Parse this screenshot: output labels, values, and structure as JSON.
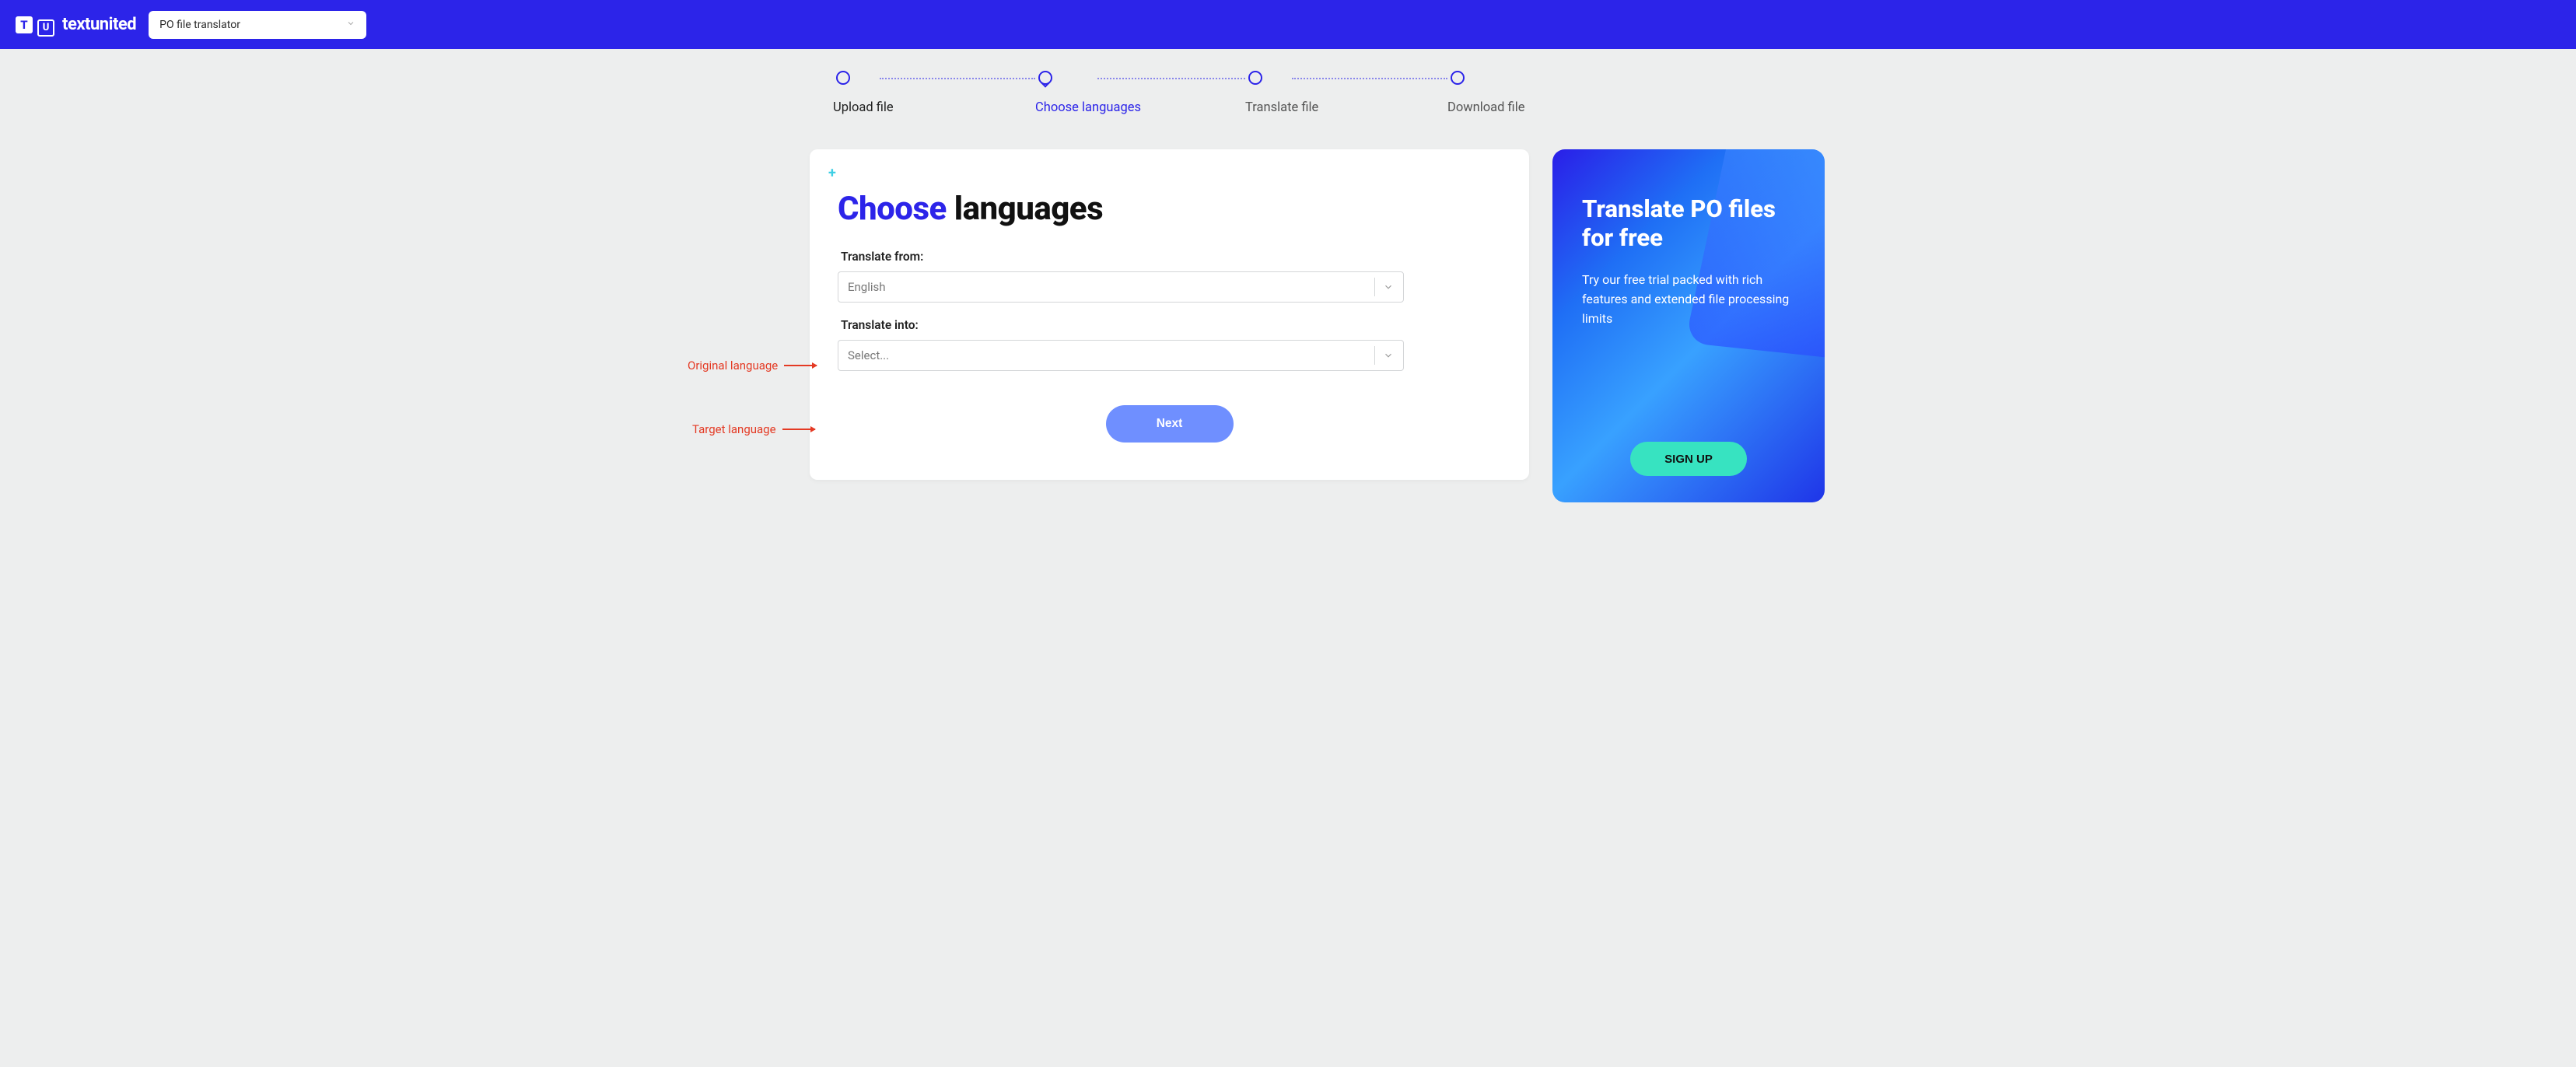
{
  "header": {
    "brand": "textunited",
    "selector_value": "PO file translator"
  },
  "stepper": {
    "steps": [
      {
        "label": "Upload file"
      },
      {
        "label": "Choose languages"
      },
      {
        "label": "Translate file"
      },
      {
        "label": "Download file"
      }
    ]
  },
  "card": {
    "title_blue": "Choose",
    "title_rest": " languages",
    "from_label": "Translate from:",
    "from_value": "English",
    "into_label": "Translate into:",
    "into_placeholder": "Select...",
    "next_label": "Next"
  },
  "promo": {
    "title": "Translate PO files for free",
    "text": "Try our free trial packed with rich features and extended file processing limits",
    "signup_label": "SIGN UP"
  },
  "annotations": {
    "original": "Original language",
    "target": "Target language"
  }
}
